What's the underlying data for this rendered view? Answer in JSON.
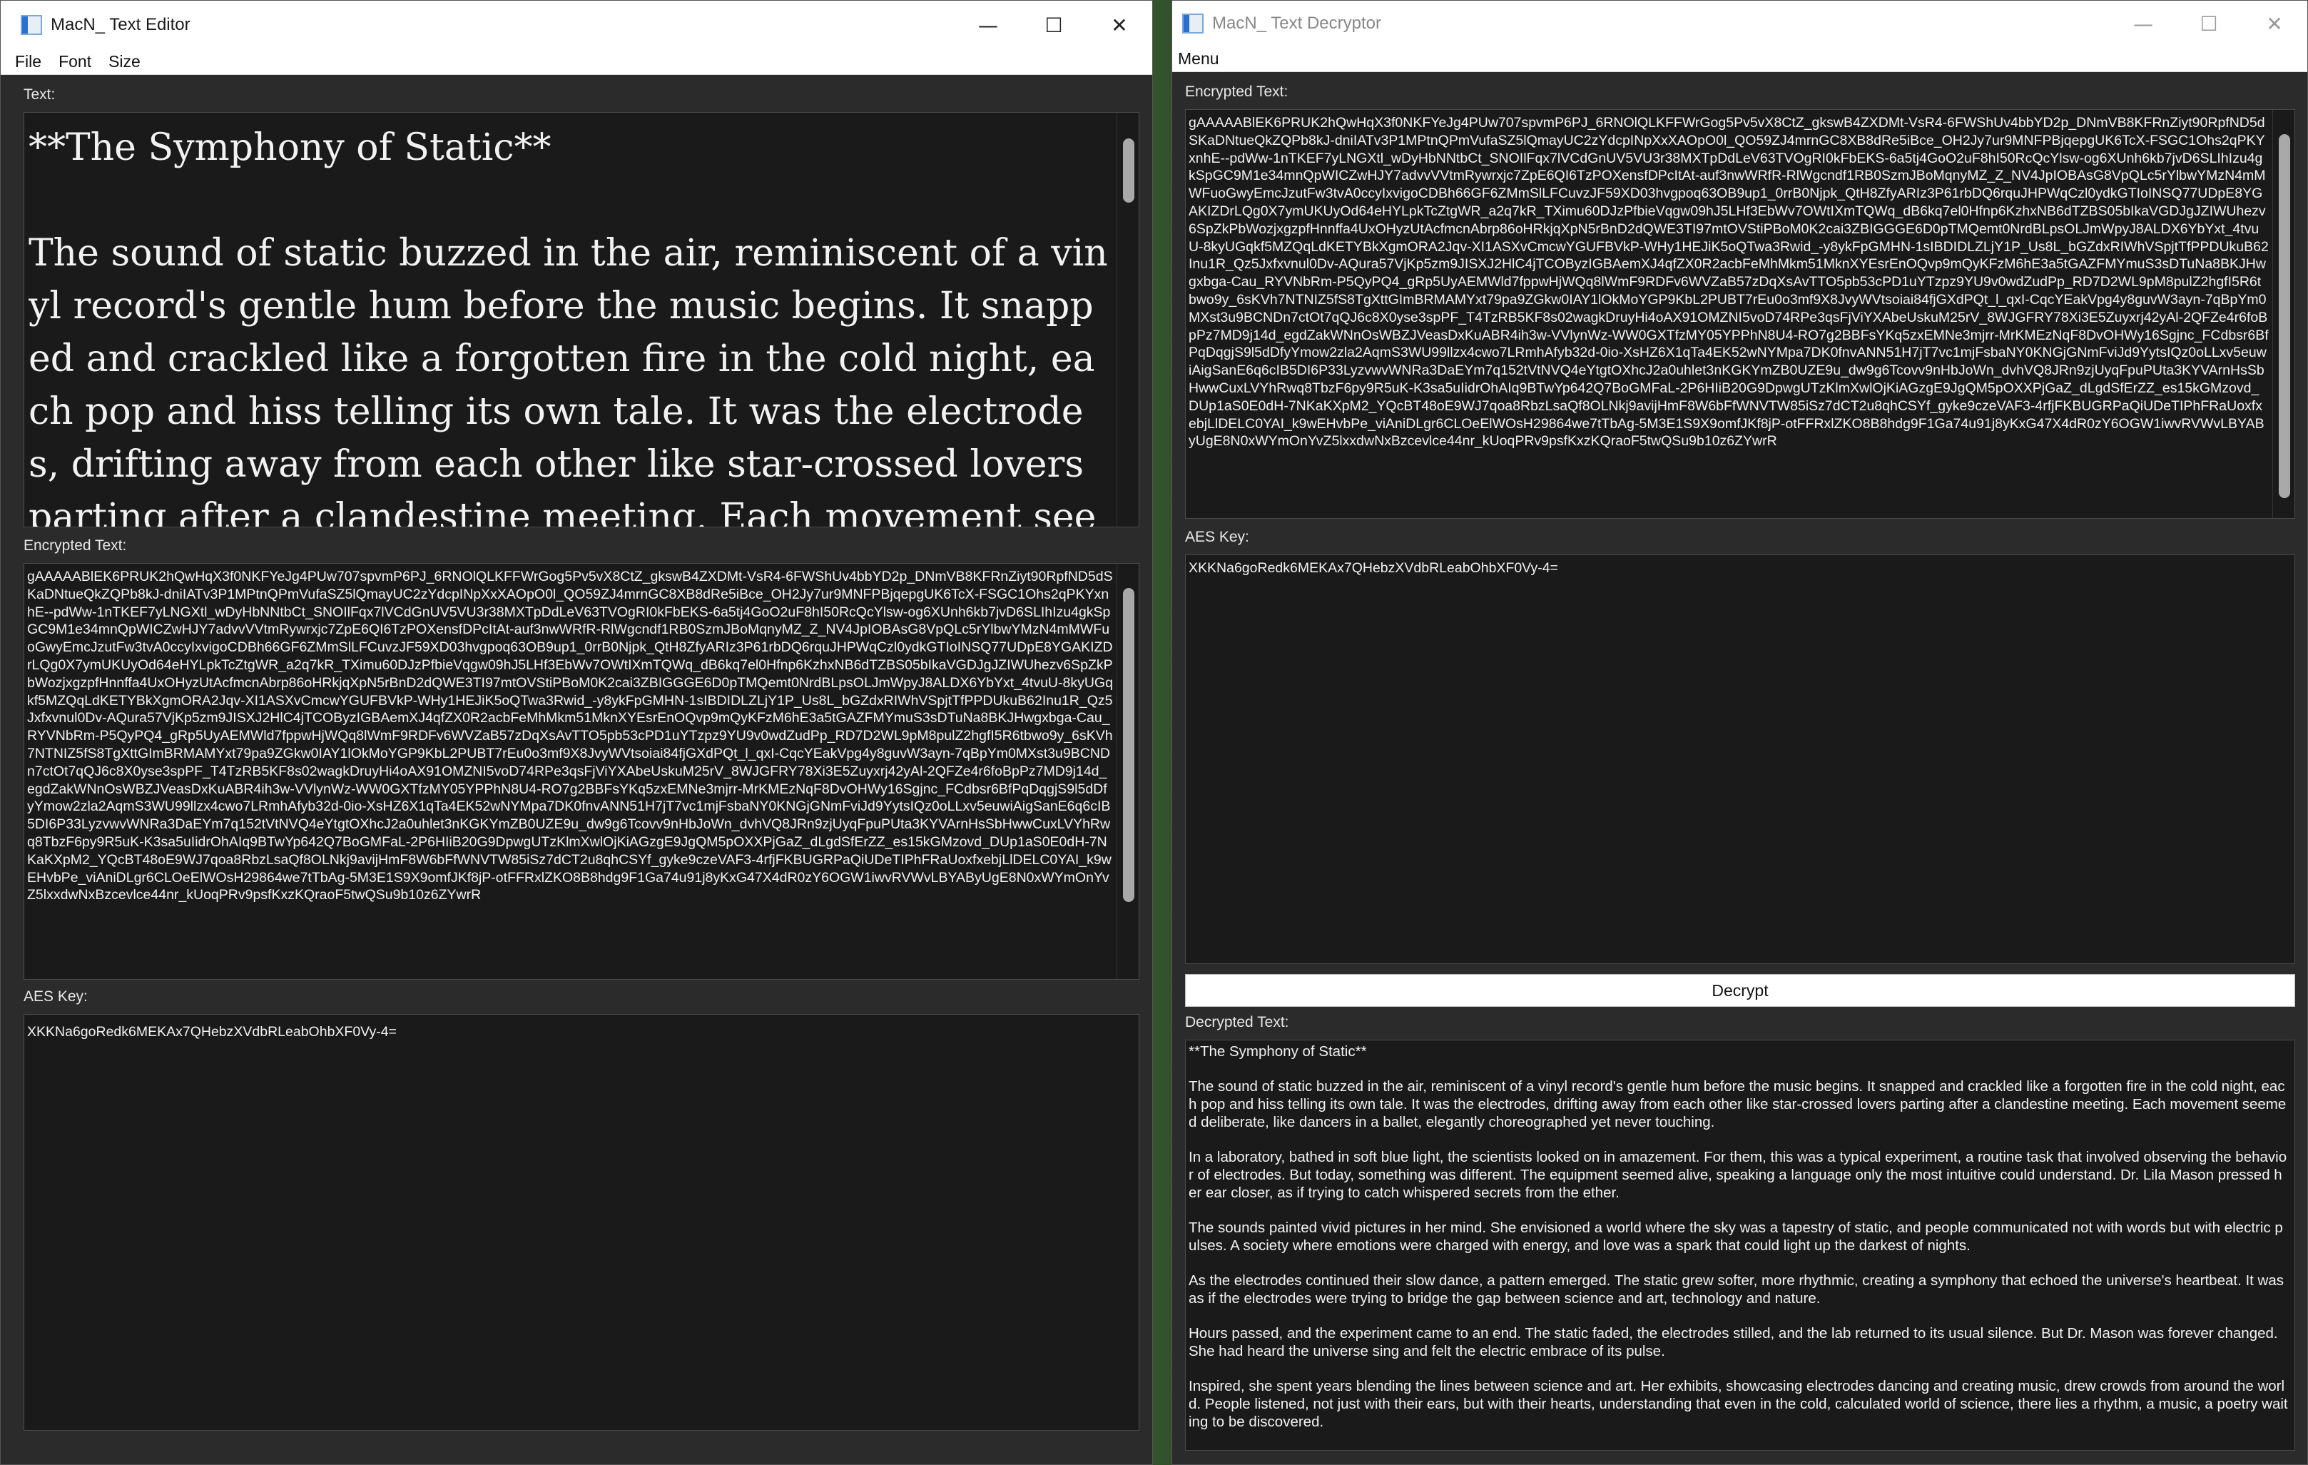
{
  "editor": {
    "title": "MacN_ Text Editor",
    "menu": [
      "File",
      "Font",
      "Size"
    ],
    "text_label": "Text:",
    "text_value": "**The Symphony of Static**\n\nThe sound of static buzzed in the air, reminiscent of a vinyl record's gentle hum before the music begins. It snapped and crackled like a forgotten fire in the cold night, each pop and hiss telling its own tale. It was the electrodes, drifting away from each other like star-crossed lovers parting after a clandestine meeting. Each movement seemed deliberate, like",
    "encrypted_label": "Encrypted Text:",
    "encrypted_value": "gAAAAABlEK6PRUK2hQwHqX3f0NKFYeJg4PUw707spvmP6PJ_6RNOlQLKFFWrGog5Pv5vX8CtZ_gkswB4ZXDMt-VsR4-6FWShUv4bbYD2p_DNmVB8KFRnZiyt90RpfND5dSKaDNtueQkZQPb8kJ-dniIATv3P1MPtnQPmVufaSZ5lQmayUC2zYdcpINpXxXAOpO0l_QO59ZJ4mrnGC8XB8dRe5iBce_OH2Jy7ur9MNFPBjqepgUK6TcX-FSGC1Ohs2qPKYxnhE--pdWw-1nTKEF7yLNGXtl_wDyHbNNtbCt_SNOIlFqx7lVCdGnUV5VU3r38MXTpDdLeV63TVOgRI0kFbEKS-6a5tj4GoO2uF8hI50RcQcYlsw-og6XUnh6kb7jvD6SLIhIzu4gkSpGC9M1e34mnQpWICZwHJY7advvVVtmRywrxjc7ZpE6QI6TzPOXensfDPcItAt-auf3nwWRfR-RlWgcndf1RB0SzmJBoMqnyMZ_Z_NV4JpIOBAsG8VpQLc5rYlbwYMzN4mMWFuoGwyEmcJzutFw3tvA0ccyIxvigoCDBh66GF6ZMmSlLFCuvzJF59XD03hvgpoq63OB9up1_0rrB0Njpk_QtH8ZfyARIz3P61rbDQ6rquJHPWqCzl0ydkGTIoINSQ77UDpE8YGAKIZDrLQg0X7ymUKUyOd64eHYLpkTcZtgWR_a2q7kR_TXimu60DJzPfbieVqgw09hJ5LHf3EbWv7OWtIXmTQWq_dB6kq7el0Hfnp6KzhxNB6dTZBS05bIkaVGDJgJZIWUhezv6SpZkPbWozjxgzpfHnnffa4UxOHyzUtAcfmcnAbrp86oHRkjqXpN5rBnD2dQWE3TI97mtOVStiPBoM0K2cai3ZBIGGGE6D0pTMQemt0NrdBLpsOLJmWpyJ8ALDX6YbYxt_4tvuU-8kyUGqkf5MZQqLdKETYBkXgmORA2Jqv-XI1ASXvCmcwYGUFBVkP-WHy1HEJiK5oQTwa3Rwid_-y8ykFpGMHN-1sIBDIDLZLjY1P_Us8L_bGZdxRIWhVSpjtTfPPDUkuB62Inu1R_Qz5Jxfxvnul0Dv-AQura57VjKp5zm9JISXJ2HlC4jTCOByzIGBAemXJ4qfZX0R2acbFeMhMkm51MknXYEsrEnOQvp9mQyKFzM6hE3a5tGAZFMYmuS3sDTuNa8BKJHwgxbga-Cau_RYVNbRm-P5QyPQ4_gRp5UyAEMWld7fppwHjWQq8lWmF9RDFv6WVZaB57zDqXsAvTTO5pb53cPD1uYTzpz9YU9v0wdZudPp_RD7D2WL9pM8pulZ2hgfI5R6tbwo9y_6sKVh7NTNIZ5fS8TgXttGImBRMAMYxt79pa9ZGkw0IAY1lOkMoYGP9KbL2PUBT7rEu0o3mf9X8JvyWVtsoiai84fjGXdPQt_l_qxI-CqcYEakVpg4y8guvW3ayn-7qBpYm0MXst3u9BCNDn7ctOt7qQJ6c8X0yse3spPF_T4TzRB5KF8s02wagkDruyHi4oAX91OMZNI5voD74RPe3qsFjViYXAbeUskuM25rV_8WJGFRY78Xi3E5Zuyxrj42yAl-2QFZe4r6foBpPz7MD9j14d_egdZakWNnOsWBZJVeasDxKuABR4ih3w-VVlynWz-WW0GXTfzMY05YPPhN8U4-RO7g2BBFsYKq5zxEMNe3mjrr-MrKMEzNqF8DvOHWy16Sgjnc_FCdbsr6BfPqDqgjS9l5dDfyYmow2zla2AqmS3WU99llzx4cwo7LRmhAfyb32d-0io-XsHZ6X1qTa4EK52wNYMpa7DK0fnvANN51H7jT7vc1mjFsbaNY0KNGjGNmFviJd9YytsIQz0oLLxv5euwiAigSanE6q6cIB5DI6P33LyzvwvWNRa3DaEYm7q152tVtNVQ4eYtgtOXhcJ2a0uhlet3nKGKYmZB0UZE9u_dw9g6Tcovv9nHbJoWn_dvhVQ8JRn9zjUyqFpuPUta3KYVArnHsSbHwwCuxLVYhRwq8TbzF6py9R5uK-K3sa5uIidrOhAIq9BTwYp642Q7BoGMFaL-2P6HIiB20G9DpwgUTzKlmXwlOjKiAGzgE9JgQM5pOXXPjGaZ_dLgdSfErZZ_es15kGMzovd_DUp1aS0E0dH-7NKaKXpM2_YQcBT48oE9WJ7qoa8RbzLsaQf8OLNkj9avijHmF8W6bFfWNVTW85iSz7dCT2u8qhCSYf_gyke9czeVAF3-4rfjFKBUGRPaQiUDeTIPhFRaUoxfxebjLlDELC0YAI_k9wEHvbPe_viAniDLgr6CLOeElWOsH29864we7tTbAg-5M3E1S9X9omfJKf8jP-otFFRxlZKO8B8hdg9F1Ga74u91j8yKxG47X4dR0zY6OGW1iwvRVWvLBYAByUgE8N0xWYmOnYvZ5lxxdwNxBzcevlce44nr_kUoqPRv9psfKxzKQraoF5twQSu9b10z6ZYwrR"
  },
  "editor_key": {
    "label": "AES Key:",
    "value": "XKKNa6goRedk6MEKAx7QHebzXVdbRLeabOhbXF0Vy-4="
  },
  "decryptor": {
    "title": "MacN_ Text Decryptor",
    "menu": [
      "Menu"
    ],
    "encrypted_label": "Encrypted Text:",
    "key_label": "AES Key:",
    "key_value": "XKKNa6goRedk6MEKAx7QHebzXVdbRLeabOhbXF0Vy-4=",
    "decrypt_button": "Decrypt",
    "decrypted_label": "Decrypted Text:",
    "decrypted_value": "**The Symphony of Static**\n\nThe sound of static buzzed in the air, reminiscent of a vinyl record's gentle hum before the music begins. It snapped and crackled like a forgotten fire in the cold night, each pop and hiss telling its own tale. It was the electrodes, drifting away from each other like star-crossed lovers parting after a clandestine meeting. Each movement seemed deliberate, like dancers in a ballet, elegantly choreographed yet never touching.\n\nIn a laboratory, bathed in soft blue light, the scientists looked on in amazement. For them, this was a typical experiment, a routine task that involved observing the behavior of electrodes. But today, something was different. The equipment seemed alive, speaking a language only the most intuitive could understand. Dr. Lila Mason pressed her ear closer, as if trying to catch whispered secrets from the ether.\n\nThe sounds painted vivid pictures in her mind. She envisioned a world where the sky was a tapestry of static, and people communicated not with words but with electric pulses. A society where emotions were charged with energy, and love was a spark that could light up the darkest of nights.\n\nAs the electrodes continued their slow dance, a pattern emerged. The static grew softer, more rhythmic, creating a symphony that echoed the universe's heartbeat. It was as if the electrodes were trying to bridge the gap between science and art, technology and nature.\n\nHours passed, and the experiment came to an end. The static faded, the electrodes stilled, and the lab returned to its usual silence. But Dr. Mason was forever changed. She had heard the universe sing and felt the electric embrace of its pulse.\n\nInspired, she spent years blending the lines between science and art. Her exhibits, showcasing electrodes dancing and creating music, drew crowds from around the world. People listened, not just with their ears, but with their hearts, understanding that even in the cold, calculated world of science, there lies a rhythm, a music, a poetry waiting to be discovered."
  },
  "icons": {
    "app": "notepad-app-icon",
    "minimize": "minimize-icon",
    "maximize": "maximize-icon",
    "close": "close-icon"
  }
}
